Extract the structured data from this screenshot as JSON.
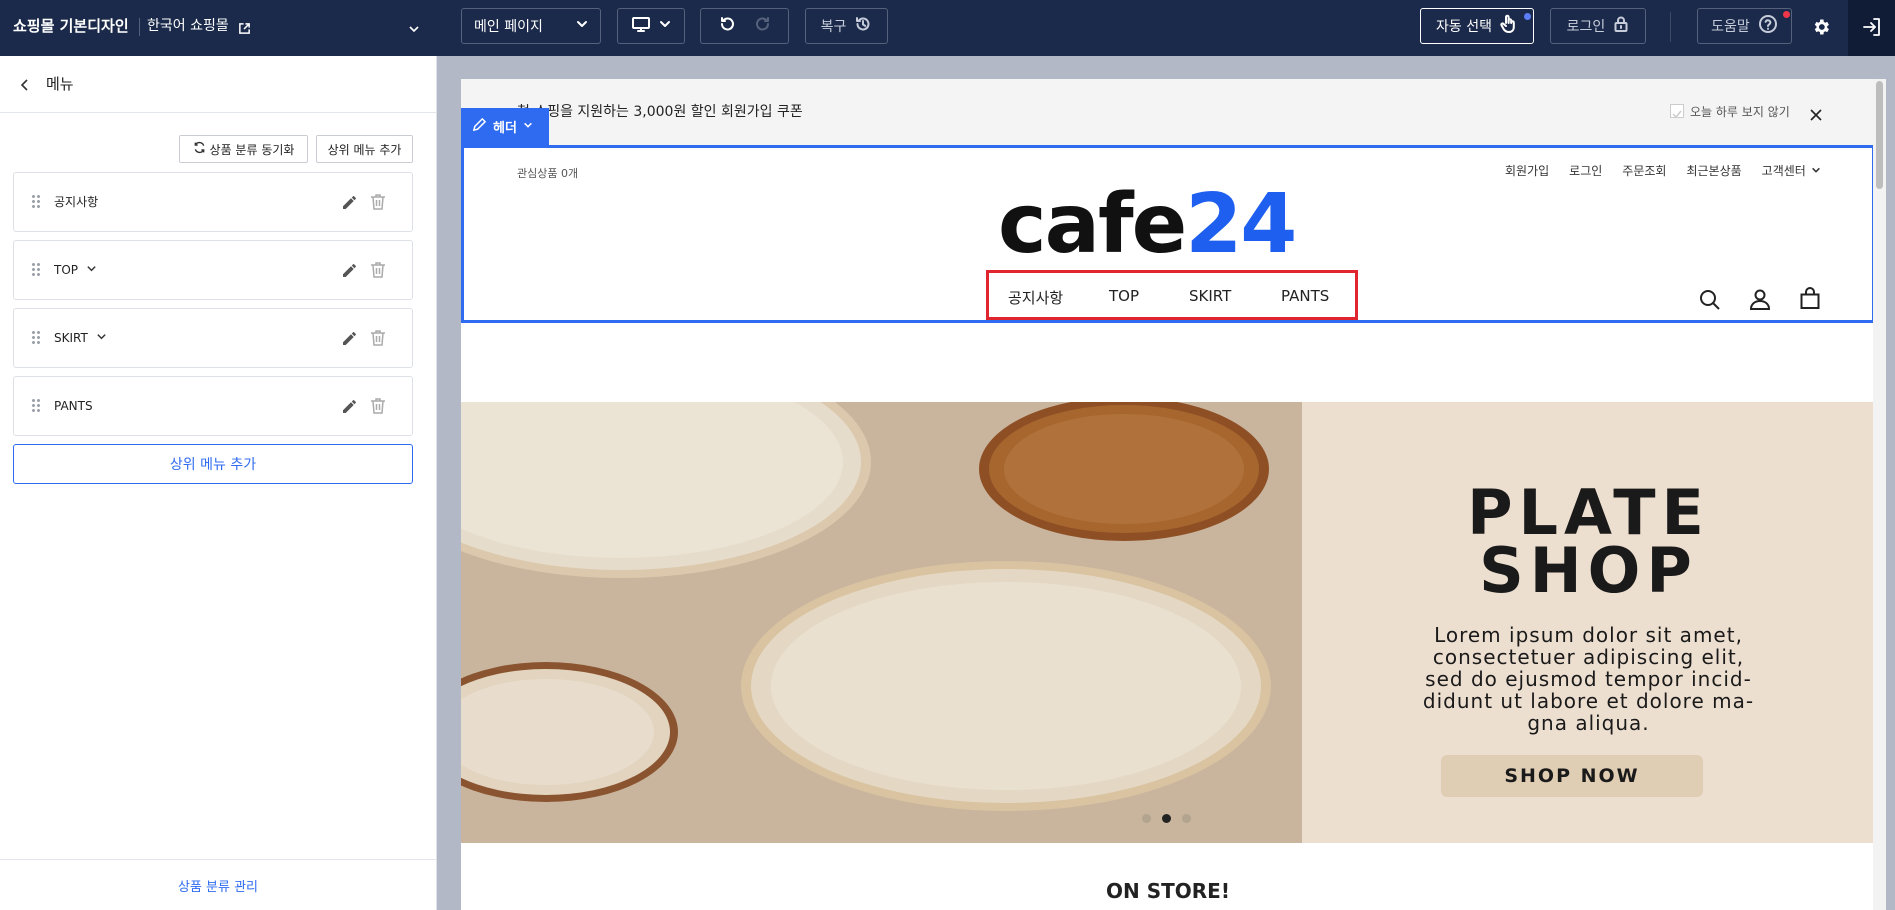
{
  "topbar": {
    "design_title": "쇼핑몰 기본디자인",
    "shop_name": "한국어 쇼핑몰",
    "page_select": "메인 페이지",
    "restore_label": "복구",
    "auto_select_label": "자동 선택",
    "login_label": "로그인",
    "help_label": "도움말"
  },
  "sidebar": {
    "title": "메뉴",
    "sync_button": "상품 분류 동기화",
    "add_top_small": "상위 메뉴 추가",
    "items": [
      {
        "label": "공지사항",
        "has_children": false
      },
      {
        "label": "TOP",
        "has_children": true
      },
      {
        "label": "SKIRT",
        "has_children": true
      },
      {
        "label": "PANTS",
        "has_children": false
      }
    ],
    "add_top_button": "상위 메뉴 추가",
    "footer_link": "상품 분류 관리"
  },
  "preview": {
    "promo_text": "첫 쇼핑을 지원하는 3,000원 할인 회원가입 쿠폰",
    "promo_hide_today": "오늘 하루 보지 않기",
    "header_tag": "헤더",
    "wishlist": "관심상품 0개",
    "util_links": [
      "회원가입",
      "로그인",
      "주문조회",
      "최근본상품",
      "고객센터"
    ],
    "logo": {
      "part1": "cafe",
      "part2": "24"
    },
    "nav": [
      "공지사항",
      "TOP",
      "SKIRT",
      "PANTS"
    ],
    "banner": {
      "title_line1": "PLATE",
      "title_line2": "SHOP",
      "body": [
        "Lorem ipsum dolor sit amet,",
        "consectetuer adipiscing elit,",
        "sed do ejusmod tempor incid-",
        "didunt ut labore et dolore ma-",
        "gna aliqua."
      ],
      "cta": "SHOP NOW",
      "slide_count": 3,
      "active_slide": 2
    },
    "section_title": "ON STORE!"
  },
  "colors": {
    "topbar_bg": "#1b2a4a",
    "header_outline": "#2f6bf0",
    "nav_highlight": "#e0252f",
    "logo_blue": "#1e5ff0",
    "link_blue": "#2f6bf0",
    "banner_right_bg": "#eddfd0"
  }
}
